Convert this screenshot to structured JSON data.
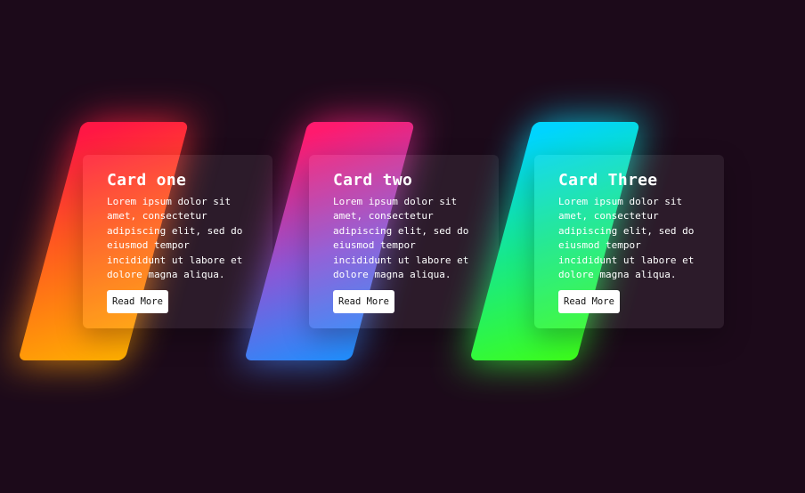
{
  "colors": {
    "background": "#1c0a1a",
    "panel": "rgba(255,255,255,0.07)",
    "button_bg": "#ffffff"
  },
  "cards": [
    {
      "title": "Card one",
      "body": "Lorem ipsum dolor sit amet, consectetur adipiscing elit, sed do eiusmod tempor incididunt ut labore et dolore magna aliqua.",
      "button_label": "Read More",
      "gradient": [
        "#ff1744",
        "#ff5a1f",
        "#ffb000"
      ]
    },
    {
      "title": "Card two",
      "body": "Lorem ipsum dolor sit amet, consectetur adipiscing elit, sed do eiusmod tempor incididunt ut labore et dolore magna aliqua.",
      "button_label": "Read More",
      "gradient": [
        "#ff1a6e",
        "#8a57d6",
        "#1e90ff"
      ]
    },
    {
      "title": "Card Three",
      "body": "Lorem ipsum dolor sit amet, consectetur adipiscing elit, sed do eiusmod tempor incididunt ut labore et dolore magna aliqua.",
      "button_label": "Read More",
      "gradient": [
        "#00d4ff",
        "#17e88a",
        "#3dff1a"
      ]
    }
  ]
}
